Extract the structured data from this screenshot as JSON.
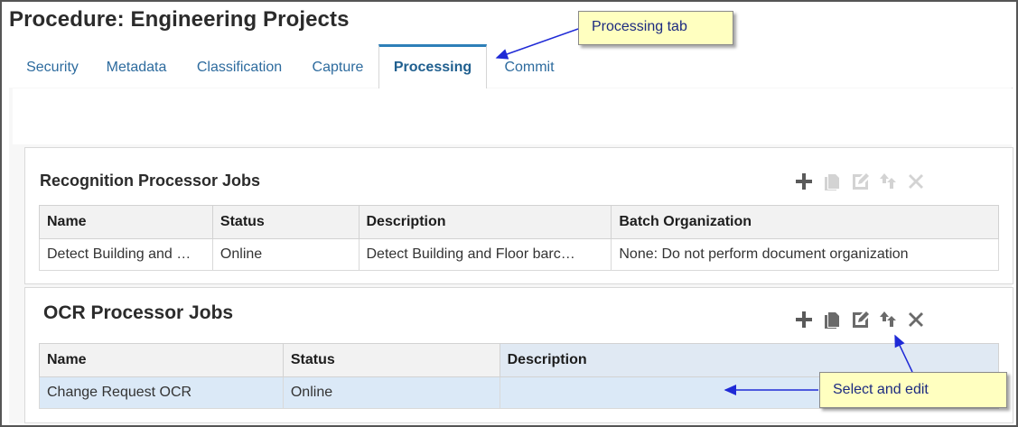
{
  "page": {
    "title": "Procedure: Engineering Projects"
  },
  "tabs": [
    {
      "label": "Security",
      "active": false
    },
    {
      "label": "Metadata",
      "active": false
    },
    {
      "label": "Classification",
      "active": false
    },
    {
      "label": "Capture",
      "active": false
    },
    {
      "label": "Processing",
      "active": true
    },
    {
      "label": "Commit",
      "active": false
    }
  ],
  "recognition": {
    "title": "Recognition Processor Jobs",
    "columns": [
      "Name",
      "Status",
      "Description",
      "Batch Organization"
    ],
    "rows": [
      [
        "Detect Building and …",
        "Online",
        "Detect Building and Floor barc…",
        "None: Do not perform document organization"
      ]
    ],
    "toolbar": [
      "add-icon",
      "copy-icon",
      "edit-icon",
      "promote-icon",
      "delete-icon"
    ]
  },
  "ocr": {
    "title": "OCR Processor Jobs",
    "columns": [
      "Name",
      "Status",
      "Description"
    ],
    "rows": [
      [
        "Change Request OCR",
        "Online",
        ""
      ]
    ],
    "toolbar": [
      "add-icon",
      "copy-icon",
      "edit-icon",
      "promote-icon",
      "delete-icon"
    ]
  },
  "callouts": {
    "processing_tab": "Processing  tab",
    "select_edit": "Select and edit"
  },
  "colors": {
    "tab_text": "#2d6b9e",
    "active_tab_border": "#2d7fb8",
    "selected_row": "#dbe9f7",
    "callout_bg": "#ffffc0",
    "callout_text": "#1c2a80",
    "arrow": "#1f2ad6"
  }
}
